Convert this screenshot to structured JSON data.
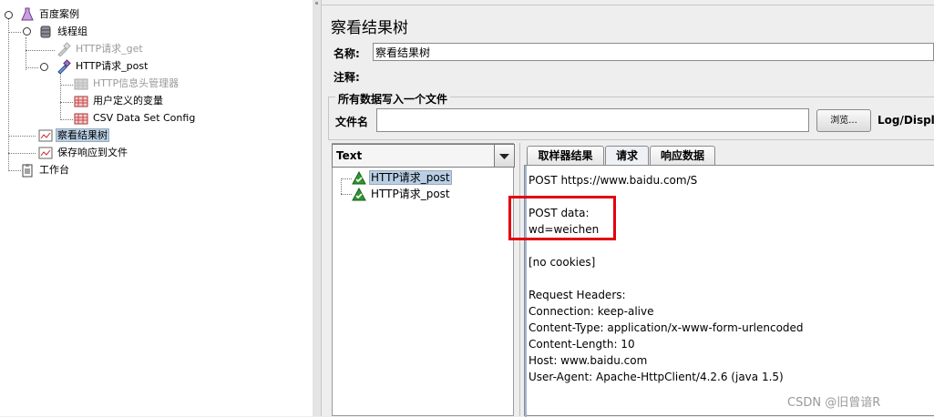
{
  "tree": {
    "items": [
      {
        "label": "百度案例"
      },
      {
        "label": "线程组"
      },
      {
        "label": "HTTP请求_get"
      },
      {
        "label": "HTTP请求_post"
      },
      {
        "label": "HTTP信息头管理器"
      },
      {
        "label": "用户定义的变量"
      },
      {
        "label": "CSV Data Set Config"
      },
      {
        "label": "察看结果树"
      },
      {
        "label": "保存响应到文件"
      },
      {
        "label": "工作台"
      }
    ]
  },
  "panel": {
    "title": "察看结果树",
    "name_label": "名称:",
    "name_value": "察看结果树",
    "comment_label": "注释:",
    "group_title": "所有数据写入一个文件",
    "file_label": "文件名",
    "browse_button": "浏览...",
    "log_label": "Log/Display"
  },
  "results": {
    "renderer": "Text",
    "samples": [
      {
        "label": "HTTP请求_post",
        "status": "success"
      },
      {
        "label": "HTTP请求_post",
        "status": "success"
      }
    ]
  },
  "tabs": [
    {
      "label": "取样器结果",
      "active": false
    },
    {
      "label": "请求",
      "active": true
    },
    {
      "label": "响应数据",
      "active": false
    }
  ],
  "request": {
    "lines": [
      "POST https://www.baidu.com/S",
      "",
      "POST data:",
      "wd=weichen",
      "",
      "[no cookies]",
      "",
      "Request Headers:",
      "Connection: keep-alive",
      "Content-Type: application/x-www-form-urlencoded",
      "Content-Length: 10",
      "Host: www.baidu.com",
      "User-Agent: Apache-HttpClient/4.2.6 (java 1.5)"
    ]
  },
  "watermark": "CSDN @旧曾谙R",
  "colors": {
    "highlight_box": "#e3000f",
    "selection": "#b8cfe5",
    "success_icon": "#2e9a2e"
  }
}
